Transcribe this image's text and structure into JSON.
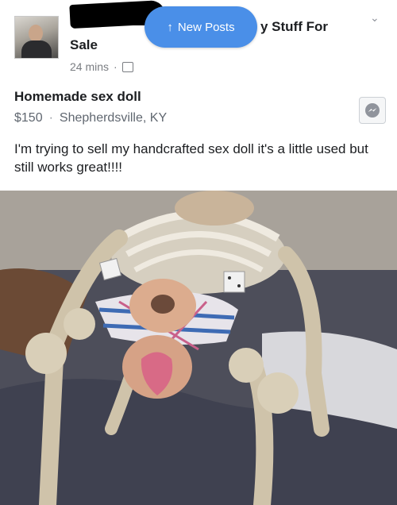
{
  "header": {
    "title_tail": "y Stuff For",
    "title_line2": "Sale",
    "time": "24 mins",
    "new_posts_label": "New Posts"
  },
  "listing": {
    "title": "Homemade sex doll",
    "price": "$150",
    "location": "Shepherdsville, KY",
    "description": "I'm trying to sell my handcrafted sex doll it's a little used but still works great!!!!"
  },
  "icons": {
    "avatar": "profile-photo",
    "group": "group-icon",
    "messenger": "messenger-icon",
    "chevron": "chevron-down-icon",
    "arrow": "arrow-up-icon"
  },
  "colors": {
    "new_posts_bg": "#4a8fe8",
    "meta_text": "#7a7d82"
  }
}
